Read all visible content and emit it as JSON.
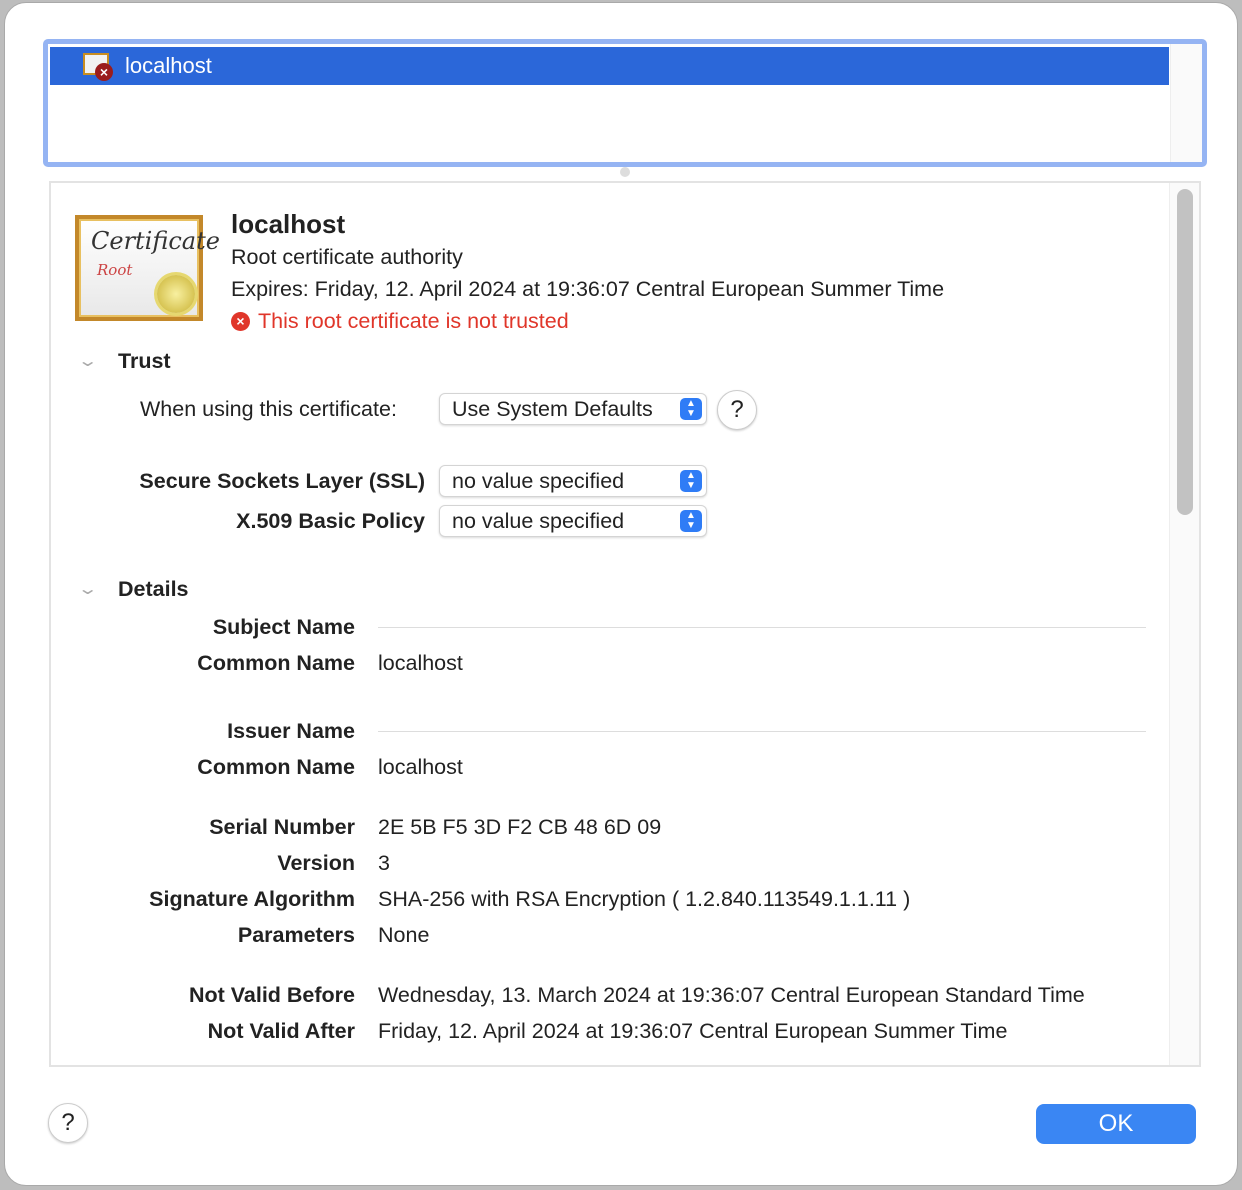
{
  "list": {
    "items": [
      {
        "name": "localhost",
        "selected": true
      }
    ]
  },
  "cert": {
    "name": "localhost",
    "kind": "Root certificate authority",
    "expires": "Expires: Friday, 12. April 2024 at 19:36:07 Central European Summer Time",
    "status": "This root certificate is not trusted",
    "image_text": [
      "Certificate",
      "Root"
    ]
  },
  "trust": {
    "heading": "Trust",
    "when_using_label": "When using this certificate:",
    "when_using_value": "Use System Defaults",
    "policies": [
      {
        "label": "Secure Sockets Layer (SSL)",
        "value": "no value specified"
      },
      {
        "label": "X.509 Basic Policy",
        "value": "no value specified"
      }
    ]
  },
  "details": {
    "heading": "Details",
    "subject_name": "Subject Name",
    "subject_cn_label": "Common Name",
    "subject_cn": "localhost",
    "issuer_name": "Issuer Name",
    "issuer_cn_label": "Common Name",
    "issuer_cn": "localhost",
    "fields": [
      {
        "label": "Serial Number",
        "value": "2E 5B F5 3D F2 CB 48 6D 09"
      },
      {
        "label": "Version",
        "value": "3"
      },
      {
        "label": "Signature Algorithm",
        "value": "SHA-256 with RSA Encryption ( 1.2.840.113549.1.1.11 )"
      },
      {
        "label": "Parameters",
        "value": "None"
      },
      {
        "label": "Not Valid Before",
        "value": "Wednesday, 13. March 2024 at 19:36:07 Central European Standard Time"
      },
      {
        "label": "Not Valid After",
        "value": "Friday, 12. April 2024 at 19:36:07 Central European Summer Time"
      }
    ]
  },
  "buttons": {
    "help": "?",
    "ok": "OK"
  },
  "colors": {
    "selection": "#2b67d9",
    "accent": "#3a86f3",
    "error": "#e0362a"
  }
}
